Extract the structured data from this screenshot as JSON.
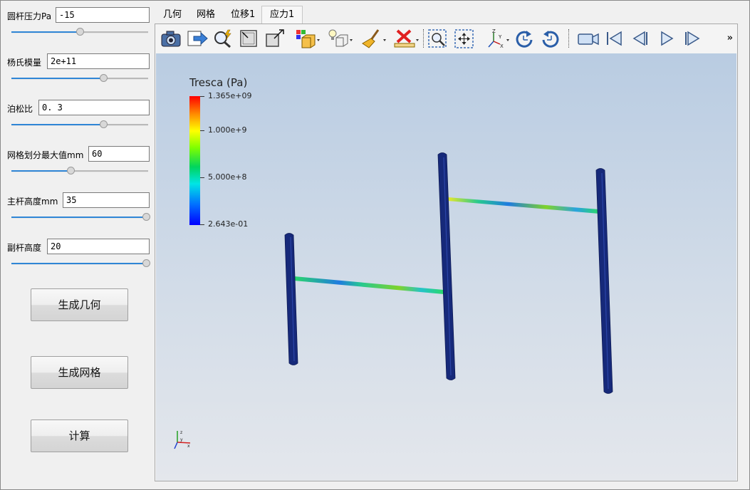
{
  "params": [
    {
      "label": "圆杆压力Pa",
      "value": "-15",
      "slider": 0.5
    },
    {
      "label": "杨氏模量",
      "value": "2e+11",
      "slider": 0.68
    },
    {
      "label": "泊松比",
      "value": "0. 3",
      "slider": 0.68
    },
    {
      "label": "网格划分最大值mm",
      "value": "60",
      "slider": 0.43
    },
    {
      "label": "主杆高度mm",
      "value": "35",
      "slider": 1.0
    },
    {
      "label": "副杆高度",
      "value": "20",
      "slider": 1.0
    }
  ],
  "buttons": {
    "generate_geometry": "生成几何",
    "generate_mesh": "生成网格",
    "compute": "计算"
  },
  "tabs": [
    {
      "label": "几何",
      "active": false
    },
    {
      "label": "网格",
      "active": false
    },
    {
      "label": "位移1",
      "active": false
    },
    {
      "label": "应力1",
      "active": true
    }
  ],
  "toolbar": {
    "icons": [
      "camera-icon",
      "export-icon",
      "query-icon",
      "zoom-to-box-icon",
      "view-extent-icon",
      "display-mode-icon",
      "light-icon",
      "clear-icon",
      "delete-icon",
      "zoom-selection-icon",
      "pan-icon",
      "axes-orientation-icon",
      "rotate-cw-icon",
      "rotate-ccw-icon",
      "camera-record-icon",
      "first-frame-icon",
      "prev-frame-icon",
      "play-icon",
      "last-frame-icon"
    ],
    "overflow": "»"
  },
  "colorbar": {
    "title": "Tresca (Pa)",
    "labels": [
      "1.365e+09",
      "1.000e+9",
      "5.000e+8",
      "2.643e-01"
    ],
    "values": [
      1365000000.0,
      1000000000.0,
      500000000.0,
      0.2643
    ],
    "colors": [
      "#ff0000",
      "#ffff00",
      "#00d45e",
      "#0000ff"
    ]
  },
  "axes": {
    "x": "x",
    "y": "y",
    "z": "z"
  }
}
